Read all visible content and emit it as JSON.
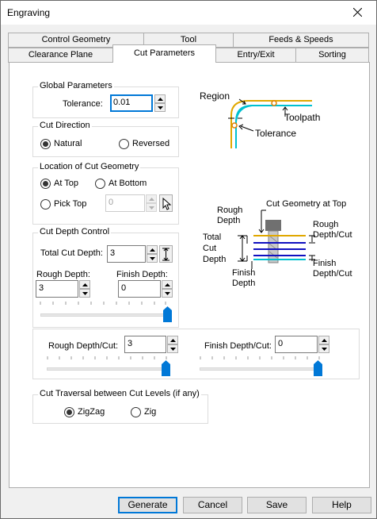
{
  "window": {
    "title": "Engraving"
  },
  "tabs": {
    "row_top": [
      {
        "label": "Control Geometry"
      },
      {
        "label": "Tool"
      },
      {
        "label": "Feeds & Speeds"
      }
    ],
    "row_bottom": [
      {
        "label": "Clearance Plane"
      },
      {
        "label": "Cut Parameters",
        "active": true
      },
      {
        "label": "Entry/Exit"
      },
      {
        "label": "Sorting"
      }
    ]
  },
  "global_parameters": {
    "legend": "Global Parameters",
    "tolerance_label": "Tolerance:",
    "tolerance_value": "0.01"
  },
  "cut_direction": {
    "legend": "Cut Direction",
    "natural_label": "Natural",
    "reversed_label": "Reversed",
    "selected": "Natural"
  },
  "location": {
    "legend": "Location of Cut Geometry",
    "at_top_label": "At Top",
    "at_bottom_label": "At Bottom",
    "pick_top_label": "Pick Top",
    "pick_top_value": "0",
    "selected": "At Top"
  },
  "cut_depth": {
    "legend": "Cut Depth Control",
    "total_label": "Total Cut Depth:",
    "total_value": "3",
    "rough_label": "Rough Depth:",
    "rough_value": "3",
    "finish_label": "Finish Depth:",
    "finish_value": "0",
    "slider_fraction": 1.0
  },
  "per_cut": {
    "rough_label": "Rough Depth/Cut:",
    "rough_value": "3",
    "finish_label": "Finish Depth/Cut:",
    "finish_value": "0",
    "rough_slider_fraction": 1.0,
    "finish_slider_fraction": 1.0
  },
  "traversal": {
    "legend": "Cut Traversal between Cut Levels (if any)",
    "zigzag_label": "ZigZag",
    "zig_label": "Zig",
    "selected": "ZigZag"
  },
  "diagram_top": {
    "region": "Region",
    "toolpath": "Toolpath",
    "tolerance": "Tolerance"
  },
  "diagram_bottom": {
    "cut_geometry": "Cut Geometry at Top",
    "rough_depth": [
      "Rough",
      "Depth"
    ],
    "total_cut_depth": [
      "Total",
      "Cut",
      "Depth"
    ],
    "finish_depth": [
      "Finish",
      "Depth"
    ],
    "rough_depth_cut": [
      "Rough",
      "Depth/Cut"
    ],
    "finish_depth_cut": [
      "Finish",
      "Depth/Cut"
    ]
  },
  "buttons": {
    "generate": "Generate",
    "cancel": "Cancel",
    "save": "Save",
    "help": "Help"
  },
  "colors": {
    "accent": "#0078d7",
    "region_curve": "#e0a800",
    "toolpath_curve": "#00c0d0",
    "cut_level": "#1010c0"
  }
}
